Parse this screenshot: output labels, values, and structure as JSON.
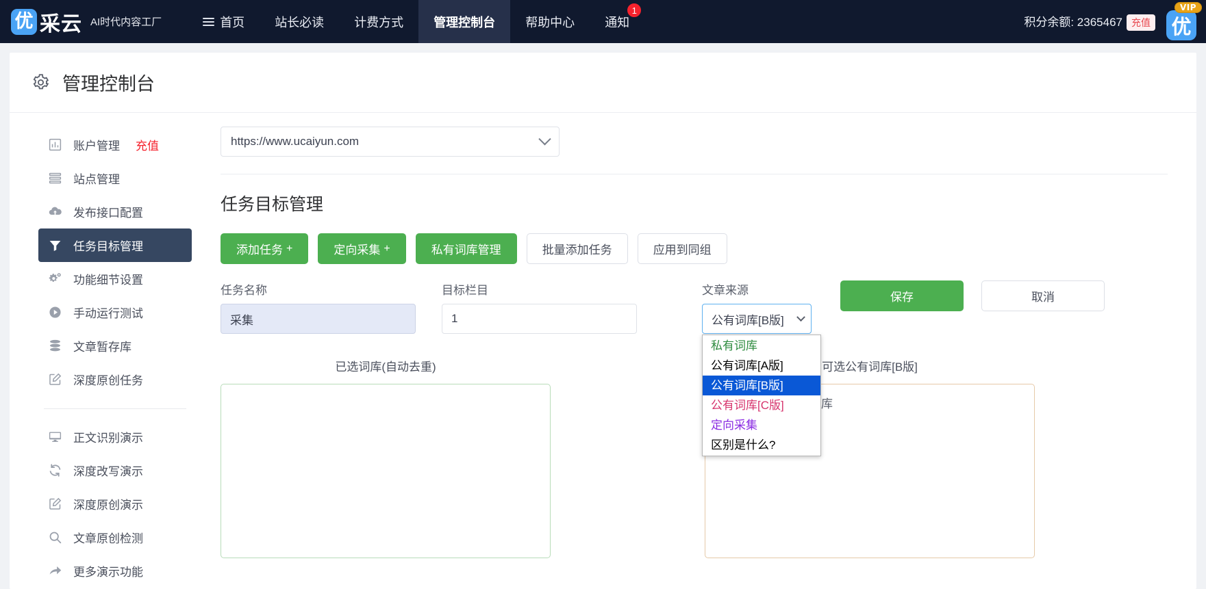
{
  "topnav": {
    "logo_badge": "优",
    "logo_text": "采云",
    "tagline": "AI时代内容工厂",
    "items": [
      {
        "label": "首页",
        "icon": "hamburger-icon",
        "active": false,
        "badge": ""
      },
      {
        "label": "站长必读",
        "icon": "",
        "active": false,
        "badge": ""
      },
      {
        "label": "计费方式",
        "icon": "",
        "active": false,
        "badge": ""
      },
      {
        "label": "管理控制台",
        "icon": "",
        "active": true,
        "badge": ""
      },
      {
        "label": "帮助中心",
        "icon": "",
        "active": false,
        "badge": ""
      },
      {
        "label": "通知",
        "icon": "",
        "active": false,
        "badge": "1"
      }
    ],
    "credits_label": "积分余额: 2365467",
    "recharge_label": "充值",
    "vip_label": "VIP",
    "avatar_text": "优"
  },
  "page": {
    "title": "管理控制台",
    "gear_icon": "gear-icon"
  },
  "sidebar": {
    "items": [
      {
        "label": "账户管理",
        "extra": "充值",
        "icon": "bar-chart-icon",
        "active": false
      },
      {
        "label": "站点管理",
        "extra": "",
        "icon": "list-icon",
        "active": false
      },
      {
        "label": "发布接口配置",
        "extra": "",
        "icon": "cloud-upload-icon",
        "active": false
      },
      {
        "label": "任务目标管理",
        "extra": "",
        "icon": "filter-icon",
        "active": true
      },
      {
        "label": "功能细节设置",
        "extra": "",
        "icon": "gears-icon",
        "active": false
      },
      {
        "label": "手动运行测试",
        "extra": "",
        "icon": "play-circle-icon",
        "active": false
      },
      {
        "label": "文章暂存库",
        "extra": "",
        "icon": "database-icon",
        "active": false
      },
      {
        "label": "深度原创任务",
        "extra": "",
        "icon": "edit-square-icon",
        "active": false
      }
    ],
    "items2": [
      {
        "label": "正文识别演示",
        "icon": "monitor-icon"
      },
      {
        "label": "深度改写演示",
        "icon": "refresh-icon"
      },
      {
        "label": "深度原创演示",
        "icon": "edit-square-icon"
      },
      {
        "label": "文章原创检测",
        "icon": "search-icon"
      },
      {
        "label": "更多演示功能",
        "icon": "arrow-right-icon"
      }
    ]
  },
  "main": {
    "site_url": "https://www.ucaiyun.com",
    "section_title": "任务目标管理",
    "buttons": [
      {
        "label": "添加任务",
        "plus": "+",
        "style": "green"
      },
      {
        "label": "定向采集",
        "plus": "+",
        "style": "green"
      },
      {
        "label": "私有词库管理",
        "plus": "",
        "style": "green"
      },
      {
        "label": "批量添加任务",
        "plus": "",
        "style": "white"
      },
      {
        "label": "应用到同组",
        "plus": "",
        "style": "white"
      }
    ],
    "fields": {
      "task_name_label": "任务名称",
      "task_name_value": "采集",
      "target_column_label": "目标栏目",
      "target_column_value": "1",
      "source_label": "文章来源",
      "source_value": "公有词库[B版]"
    },
    "dropdown_options": [
      {
        "label": "私有词库",
        "color": "#2e8b3f",
        "selected": false
      },
      {
        "label": "公有词库[A版]",
        "color": "#000000",
        "selected": false
      },
      {
        "label": "公有词库[B版]",
        "color": "#ffffff",
        "selected": true
      },
      {
        "label": "公有词库[C版]",
        "color": "#d6336c",
        "selected": false
      },
      {
        "label": "定向采集",
        "color": "#8a2be2",
        "selected": false
      },
      {
        "label": "区别是什么?",
        "color": "#000000",
        "selected": false
      }
    ],
    "save_label": "保存",
    "cancel_label": "取消",
    "left_list_title": "已选词库(自动去重)",
    "right_list_title": "可选公有词库[B版]",
    "right_list_hint": "下面的搜索框查找词库"
  },
  "colors": {
    "nav_bg": "#10192e",
    "nav_active": "#26304a",
    "green": "#4caf50",
    "sidebar_active": "#364761",
    "red": "#f5222d",
    "dropdown_selected": "#0a58d6"
  }
}
